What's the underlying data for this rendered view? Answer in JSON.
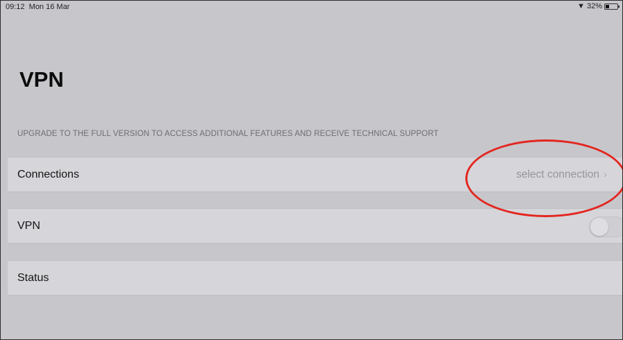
{
  "status_bar": {
    "time": "09:12",
    "date": "Mon 16 Mar",
    "battery": "32%",
    "battery_level": 0.32
  },
  "page": {
    "title": "VPN",
    "notice": "UPGRADE TO THE FULL VERSION TO ACCESS ADDITIONAL FEATURES AND RECEIVE TECHNICAL SUPPORT"
  },
  "rows": {
    "connections": {
      "label": "Connections",
      "value": "select connection"
    },
    "vpn": {
      "label": "VPN",
      "toggle_on": false
    },
    "status": {
      "label": "Status"
    }
  },
  "icons": {
    "wifi": "wifi-icon",
    "battery": "battery-icon",
    "chevron": "chevron-right-icon"
  },
  "colors": {
    "background": "#c7c6cb",
    "cell": "#d6d5d9",
    "annotation": "#e3261f"
  }
}
